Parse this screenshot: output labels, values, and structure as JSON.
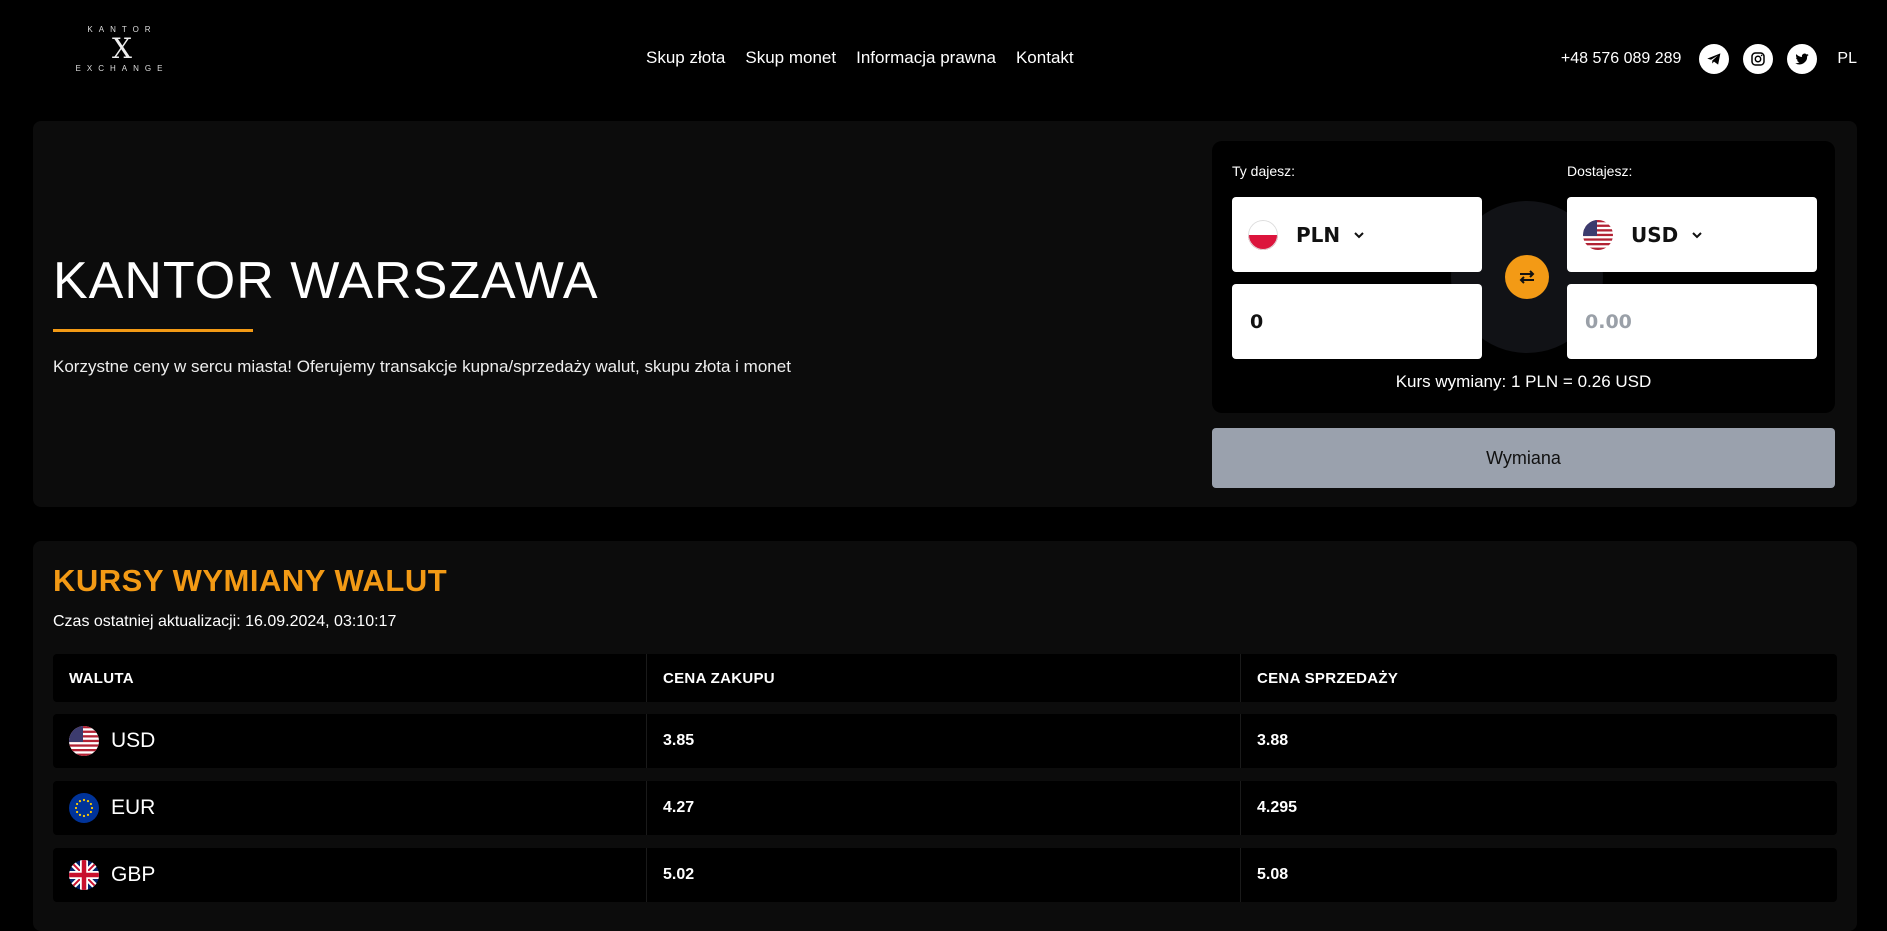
{
  "logo": {
    "top": "KANTOR",
    "mark": "X",
    "bottom": "EXCHANGE"
  },
  "nav": [
    "Skup złota",
    "Skup monet",
    "Informacja prawna",
    "Kontakt"
  ],
  "header": {
    "phone": "+48 576 089 289",
    "socials": [
      "telegram-icon",
      "instagram-icon",
      "twitter-icon"
    ],
    "language": "PL"
  },
  "hero": {
    "title": "KANTOR WARSZAWA",
    "description": "Korzystne ceny w sercu miasta! Oferujemy transakcje kupna/sprzedaży walut, skupu złota i monet"
  },
  "exchanger": {
    "give_label": "Ty dajesz:",
    "get_label": "Dostajesz:",
    "give_currency": "PLN",
    "get_currency": "USD",
    "give_amount": "0",
    "get_amount_placeholder": "0.00",
    "rate_text": "Kurs wymiany: 1 PLN = 0.26 USD",
    "submit_label": "Wymiana"
  },
  "rates": {
    "title": "KURSY WYMIANY WALUT",
    "updated": "Czas ostatniej aktualizacji: 16.09.2024, 03:10:17",
    "headers": [
      "WALUTA",
      "CENA ZAKUPU",
      "CENA SPRZEDAŻY"
    ],
    "rows": [
      {
        "code": "USD",
        "buy": "3.85",
        "sell": "3.88"
      },
      {
        "code": "EUR",
        "buy": "4.27",
        "sell": "4.295"
      },
      {
        "code": "GBP",
        "buy": "5.02",
        "sell": "5.08"
      }
    ]
  },
  "colors": {
    "accent": "#f39a15",
    "panel": "#0c0c0c",
    "button_disabled": "#9aa1ad"
  }
}
